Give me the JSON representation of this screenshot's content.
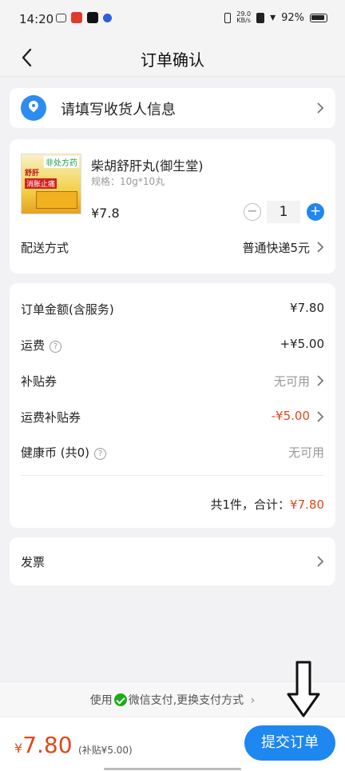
{
  "status_bar": {
    "time": "14:20",
    "net_speed": "29.0\nKB/s",
    "battery": "92%"
  },
  "nav": {
    "title": "订单确认"
  },
  "address": {
    "prompt": "请填写收货人信息"
  },
  "product": {
    "image_tag": "非处方药",
    "image_text_1": "舒肝",
    "image_text_2": "消胀止痛",
    "name": "柴胡舒肝丸(御生堂)",
    "spec": "规格：10g*10丸",
    "price": "¥7.8",
    "quantity": "1",
    "shipping_label": "配送方式",
    "shipping_value": "普通快递5元"
  },
  "fees": {
    "order_amount_label": "订单金额(含服务)",
    "order_amount_value": "¥7.80",
    "freight_label": "运费",
    "freight_value": "+¥5.00",
    "subsidy_label": "补贴券",
    "subsidy_value": "无可用",
    "freight_subsidy_label": "运费补贴券",
    "freight_subsidy_value": "-¥5.00",
    "health_coin_label": "健康币 (共0)",
    "health_coin_value": "无可用",
    "total_prefix": "共1件，合计：",
    "total_amount": "¥7.80"
  },
  "invoice": {
    "label": "发票"
  },
  "payment": {
    "hint_prefix": "使用",
    "hint_suffix": "微信支付,更换支付方式"
  },
  "bottom": {
    "currency": "¥",
    "total": "7.80",
    "subsidy_note": "(补贴¥5.00)",
    "submit_label": "提交订单"
  },
  "colors": {
    "accent_blue": "#1e87f0",
    "price_red": "#e0471a",
    "wechat_green": "#1aad19"
  }
}
